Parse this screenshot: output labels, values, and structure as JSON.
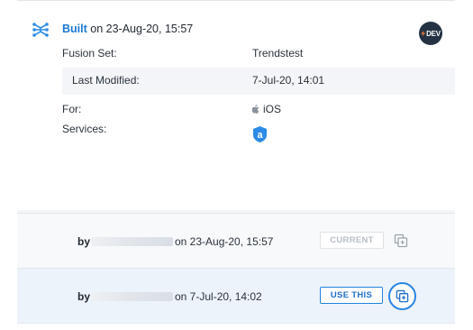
{
  "build": {
    "status_word": "Built",
    "status_rest": " on 23-Aug-20, 15:57",
    "environment_badge": "DEV",
    "environment_prefix": "+"
  },
  "details": {
    "fusion_set_label": "Fusion Set:",
    "fusion_set_value": "Trendstest",
    "last_modified_label": "Last Modified:",
    "last_modified_value": "7-Jul-20, 14:01",
    "for_label": "For:",
    "for_value": "iOS",
    "services_label": "Services:"
  },
  "history": [
    {
      "by_label": "by",
      "date": "on 23-Aug-20, 15:57",
      "action_label": "CURRENT",
      "action_enabled": false
    },
    {
      "by_label": "by",
      "date": "on 7-Jul-20, 14:02",
      "action_label": "USE THIS",
      "action_enabled": true
    }
  ],
  "icons": {
    "build": "network-nodes-icon",
    "platform": "apple-icon",
    "service": "shield-a-icon",
    "copy": "copy-icon"
  },
  "colors": {
    "accent": "#1a76d2",
    "badge_bg": "#243243",
    "badge_plus": "#ff7f3a",
    "service_badge": "#2b8be6"
  }
}
